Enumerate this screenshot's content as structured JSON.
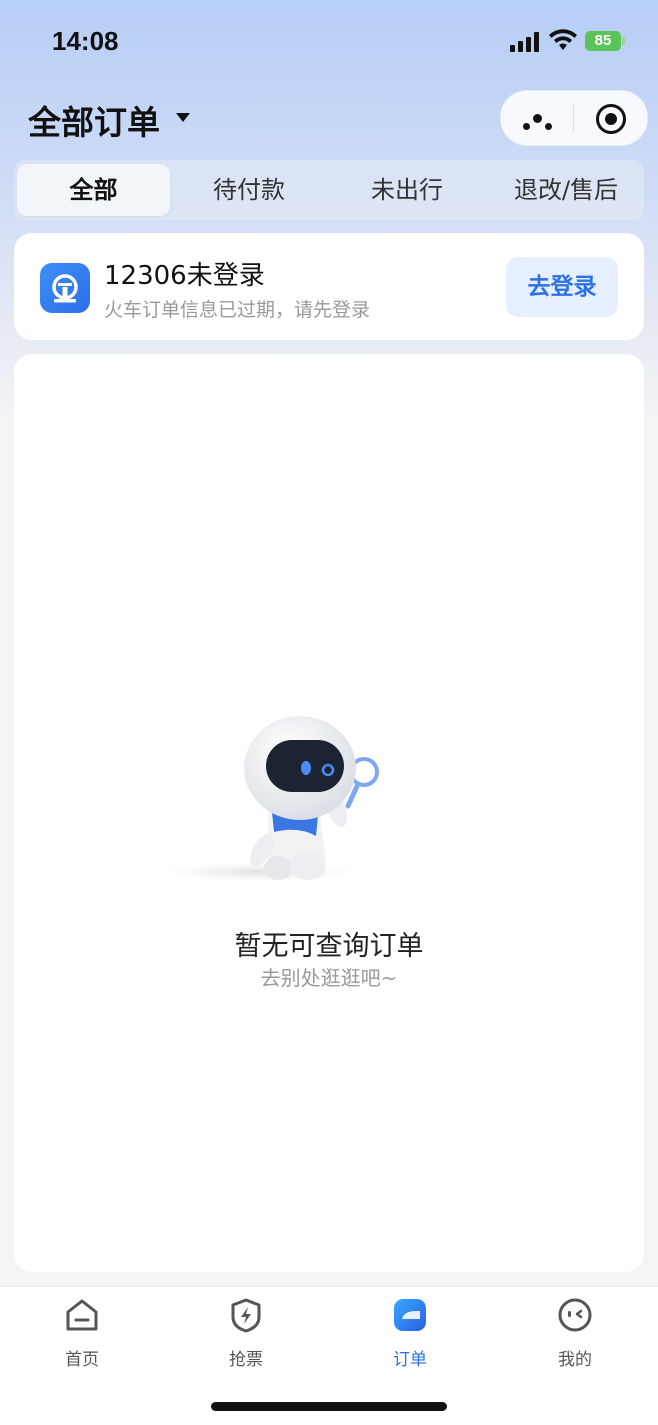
{
  "status_bar": {
    "time": "14:08",
    "battery": "85"
  },
  "header": {
    "title": "全部订单"
  },
  "tabs": [
    {
      "label": "全部"
    },
    {
      "label": "待付款"
    },
    {
      "label": "未出行"
    },
    {
      "label": "退改/售后"
    }
  ],
  "active_tab": "全部",
  "login_card": {
    "title": "12306未登录",
    "subtitle": "火车订单信息已过期，请先登录",
    "button": "去登录"
  },
  "empty_state": {
    "title": "暂无可查询订单",
    "subtitle": "去别处逛逛吧~"
  },
  "bottom_nav": [
    {
      "label": "首页",
      "icon": "home-icon"
    },
    {
      "label": "抢票",
      "icon": "lightning-shield-icon"
    },
    {
      "label": "订单",
      "icon": "order-icon"
    },
    {
      "label": "我的",
      "icon": "face-icon"
    }
  ],
  "active_nav": "订单",
  "colors": {
    "accent": "#2a72e6",
    "battery": "#5ac35a"
  }
}
